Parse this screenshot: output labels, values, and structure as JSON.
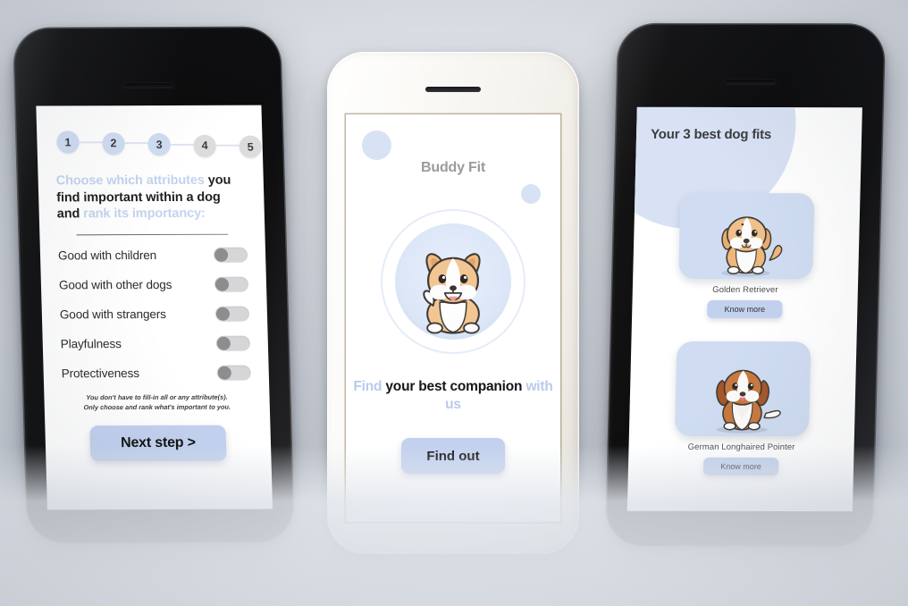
{
  "app": {
    "name": "Buddy Fit"
  },
  "screen1": {
    "steps": [
      {
        "label": "1",
        "state": "active"
      },
      {
        "label": "2",
        "state": "active"
      },
      {
        "label": "3",
        "state": "active"
      },
      {
        "label": "4",
        "state": "inactive"
      },
      {
        "label": "5",
        "state": "inactive"
      }
    ],
    "prompt": {
      "part1": "Choose which attributes",
      "part2": " you find important within a dog and ",
      "part3": "rank its importancy:"
    },
    "attributes": [
      {
        "label": "Good with children",
        "on": false
      },
      {
        "label": "Good with other dogs",
        "on": false
      },
      {
        "label": "Good with strangers",
        "on": false
      },
      {
        "label": "Playfulness",
        "on": false
      },
      {
        "label": "Protectiveness",
        "on": false
      }
    ],
    "fine_print_line1": "You don't have to fill-in all or any attribute(s).",
    "fine_print_line2": "Only choose and rank what's important to you.",
    "next_button": "Next step >"
  },
  "screen2": {
    "title": "Buddy Fit",
    "tagline_part1": "Find",
    "tagline_part2": " your best companion ",
    "tagline_part3": "with us",
    "cta_button": "Find out",
    "hero_icon": "puppy-illustration"
  },
  "screen3": {
    "title": "Your 3 best dog fits",
    "results": [
      {
        "breed": "Golden Retriever",
        "button": "Know more",
        "icon": "golden-retriever-puppy-illustration"
      },
      {
        "breed": "German Longhaired Pointer",
        "button": "Know more",
        "icon": "german-longhaired-pointer-puppy-illustration"
      }
    ]
  },
  "colors": {
    "accent_blue": "#c2d1ee",
    "soft_blue": "#d7e2f5",
    "pale_blue_text": "#b9cbea",
    "toggle_track": "#d6d6d8",
    "toggle_knob": "#8d8d90",
    "background": "#d5d9e0"
  }
}
